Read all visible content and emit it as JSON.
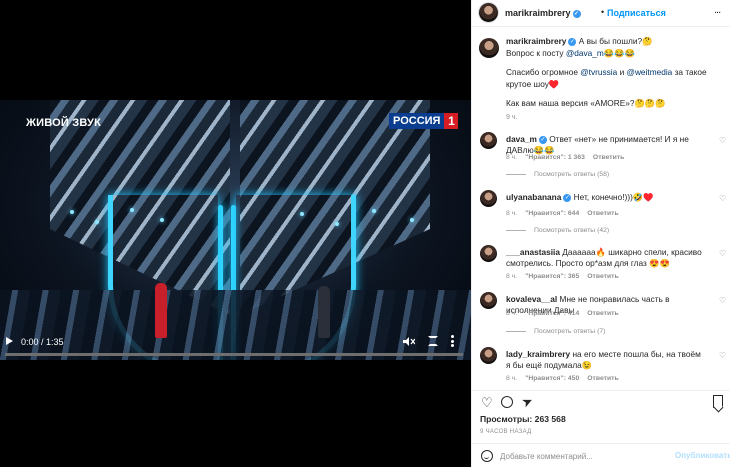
{
  "video": {
    "live_label": "ЖИВОЙ ЗВУК",
    "channel_logo": "РОССИЯ",
    "channel_number": "1",
    "time": "0:00 / 1:35",
    "progress": 0
  },
  "header": {
    "username": "marikraimbrery",
    "separator": "•",
    "follow_label": "Подписаться",
    "more": "..."
  },
  "caption": {
    "username": "marikraimbrery",
    "line1": "А вы бы пошли?🤔",
    "line2_prefix": "Вопрос к посту ",
    "mention1": "@dava_m",
    "line2_suffix": "😂😂😂",
    "line3_prefix": "Спасибо огромное ",
    "mention2": "@tvrussia",
    "line3_mid": " и ",
    "mention3": "@weitmedia",
    "line3_suffix": " за такое крутое шоу♥️",
    "line4": "Как вам наша версия «AMORE»?🤔🤔🤔",
    "time": "9 ч."
  },
  "comments": [
    {
      "username": "dava_m",
      "verified": true,
      "text": "Ответ «нет» не принимается! И я не ДАВлю😂😂",
      "age": "8 ч.",
      "likes": "\"Нравится\": 1 363",
      "reply": "Ответить",
      "replies": "Посмотреть ответы (58)"
    },
    {
      "username": "ulyanabanana",
      "verified": true,
      "text": "Нет, конечно!)))🤣♥️",
      "age": "8 ч.",
      "likes": "\"Нравится\": 644",
      "reply": "Ответить",
      "replies": "Посмотреть ответы (42)"
    },
    {
      "username": "___anastasiia",
      "verified": false,
      "text": "Даааааа🔥 шикарно спели, красиво смотрелись. Просто ор*азм для глаз 😍😍",
      "age": "8 ч.",
      "likes": "\"Нравится\": 365",
      "reply": "Ответить",
      "replies": ""
    },
    {
      "username": "kovaleva__al",
      "verified": false,
      "text": "Мне не понравилась часть в исполнении Давы",
      "age": "8 ч.",
      "likes": "\"Нравится\": 414",
      "reply": "Ответить",
      "replies": "Посмотреть ответы (7)"
    },
    {
      "username": "lady_kraimbrery",
      "verified": false,
      "text": "на его месте пошла бы, на твоём я бы ещё подумала😉",
      "age": "8 ч.",
      "likes": "\"Нравится\": 450",
      "reply": "Ответить",
      "replies": ""
    }
  ],
  "actions": {
    "like_icon": "heart-icon",
    "comment_icon": "comment-icon",
    "share_icon": "share-icon",
    "save_icon": "bookmark-icon"
  },
  "views": "Просмотры: 263 568",
  "time_ago": "9 ЧАСОВ НАЗАД",
  "add_comment": {
    "placeholder": "Добавьте комментарий...",
    "publish_label": "Опубликовать"
  },
  "colors": {
    "accent": "#0095f6",
    "stage_light": "#35d8ff",
    "logo_blue": "#0a3d8f",
    "logo_red": "#d61d24"
  }
}
